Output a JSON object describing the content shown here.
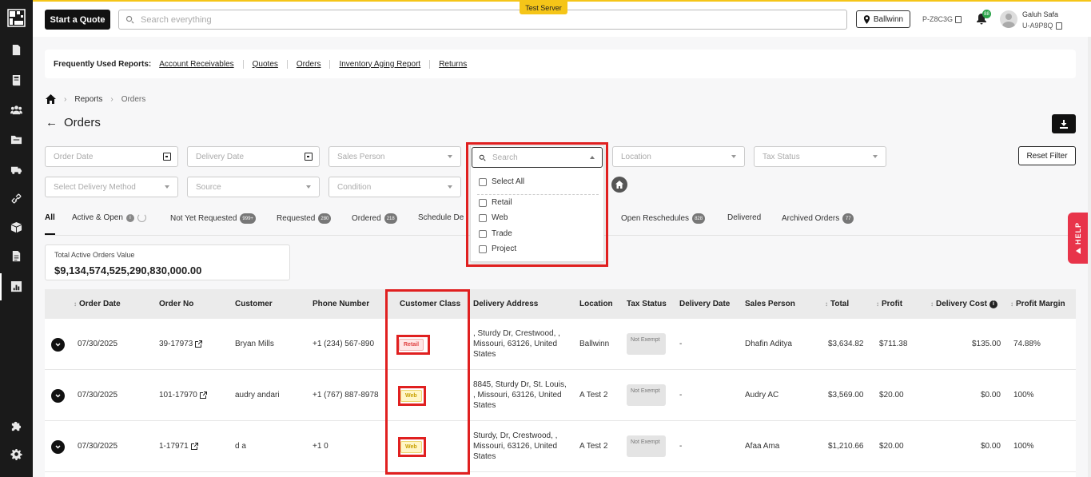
{
  "topbar": {
    "quote_btn": "Start a Quote",
    "search_placeholder": "Search everything",
    "server_label": "Test Server",
    "location": "Ballwinn",
    "pcode": "P-Z8C3G",
    "notif_count": "88",
    "user_name": "Galuh Safa",
    "user_id": "U-A9P8Q"
  },
  "sidebar": {
    "icons": [
      "logo-icon",
      "invoice-icon",
      "book-icon",
      "users-icon",
      "folder-icon",
      "truck-icon",
      "link-icon",
      "box-icon",
      "document-icon",
      "chart-icon",
      "puzzle-icon",
      "gear-icon"
    ]
  },
  "frequent": {
    "label": "Frequently Used Reports:",
    "links": [
      "Account Receivables",
      "Quotes",
      "Orders",
      "Inventory Aging Report",
      "Returns"
    ]
  },
  "breadcrumb": {
    "reports": "Reports",
    "current": "Orders"
  },
  "page": {
    "title": "Orders"
  },
  "filters": {
    "order_date": "Order Date",
    "delivery_date": "Delivery Date",
    "sales_person": "Sales Person",
    "location": "Location",
    "tax_status": "Tax Status",
    "reset": "Reset Filter",
    "delivery_method": "Select Delivery Method",
    "source": "Source",
    "condition": "Condition"
  },
  "dropdown": {
    "search_placeholder": "Search",
    "select_all": "Select All",
    "options": [
      "Retail",
      "Web",
      "Trade",
      "Project"
    ]
  },
  "tabs": {
    "all": "All",
    "active_open": "Active & Open",
    "not_yet_requested": "Not Yet Requested",
    "not_yet_requested_badge": "999+",
    "requested": "Requested",
    "requested_badge": "280",
    "ordered": "Ordered",
    "ordered_badge": "218",
    "schedule": "Schedule De",
    "open_reschedules": "Open Reschedules",
    "open_reschedules_badge": "828",
    "delivered": "Delivered",
    "archived": "Archived Orders",
    "archived_badge": "77"
  },
  "total": {
    "label": "Total Active Orders Value",
    "value": "$9,134,574,525,290,830,000.00"
  },
  "table": {
    "headers": {
      "order_date": "Order Date",
      "order_no": "Order No",
      "customer": "Customer",
      "phone": "Phone Number",
      "customer_class": "Customer Class",
      "delivery_address": "Delivery Address",
      "location": "Location",
      "tax_status": "Tax Status",
      "delivery_date": "Delivery Date",
      "sales_person": "Sales Person",
      "total": "Total",
      "profit": "Profit",
      "delivery_cost": "Delivery Cost",
      "profit_margin": "Profit Margin"
    },
    "rows": [
      {
        "order_date": "07/30/2025",
        "order_no": "39-17973",
        "customer": "Bryan Mills",
        "phone": "+1 (234) 567-890",
        "class": "Retail",
        "address": ", Sturdy Dr, Crestwood, , Missouri, 63126, United States",
        "location": "Ballwinn",
        "tax": "Not Exempt",
        "delivery_date": "-",
        "sales_person": "Dhafin Aditya",
        "total": "$3,634.82",
        "profit": "$711.38",
        "delivery_cost": "$135.00",
        "margin": "74.88%"
      },
      {
        "order_date": "07/30/2025",
        "order_no": "101-17970",
        "customer": "audry andari",
        "phone": "+1 (767) 887-8978",
        "class": "Web",
        "address": "8845, Sturdy Dr, St. Louis, , Missouri, 63126, United States",
        "location": "A Test 2",
        "tax": "Not Exempt",
        "delivery_date": "-",
        "sales_person": "Audry AC",
        "total": "$3,569.00",
        "profit": "$20.00",
        "delivery_cost": "$0.00",
        "margin": "100%"
      },
      {
        "order_date": "07/30/2025",
        "order_no": "1-17971",
        "customer": "d a",
        "phone": "+1 0",
        "class": "Web",
        "address": "Sturdy, Dr, Crestwood, , Missouri, 63126, United States",
        "location": "A Test 2",
        "tax": "Not Exempt",
        "delivery_date": "-",
        "sales_person": "Afaa Ama",
        "total": "$1,210.66",
        "profit": "$20.00",
        "delivery_cost": "$0.00",
        "margin": "100%"
      }
    ]
  },
  "help": {
    "label": "HELP"
  }
}
